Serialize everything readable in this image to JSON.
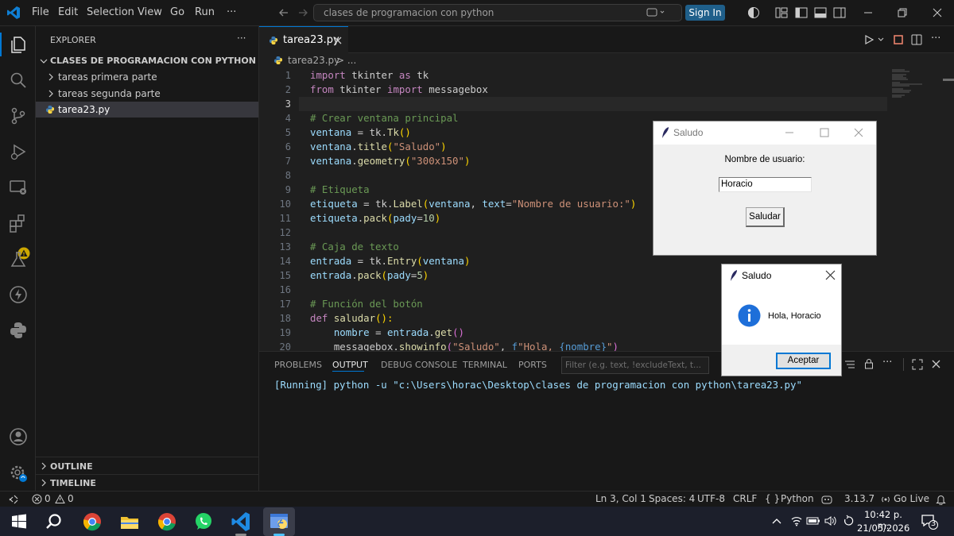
{
  "titlebar": {
    "menus": [
      "File",
      "Edit",
      "Selection",
      "View",
      "Go",
      "Run",
      "···"
    ],
    "search": "clases de programacion con python",
    "signin": "Sign In"
  },
  "sidebar": {
    "header": "EXPLORER",
    "more": "···",
    "folder": "CLASES DE PROGRAMACION CON PYTHON",
    "items": [
      {
        "label": "tareas primera parte"
      },
      {
        "label": "tareas segunda parte"
      },
      {
        "label": "tarea23.py"
      }
    ],
    "outline": "OUTLINE",
    "timeline": "TIMELINE"
  },
  "editor": {
    "tab_label": "tarea23.py",
    "breadcrumb_file": "tarea23.py",
    "breadcrumb_rest": "> ...",
    "line_numbers": [
      "1",
      "2",
      "3",
      "4",
      "5",
      "6",
      "7",
      "8",
      "9",
      "10",
      "11",
      "12",
      "13",
      "14",
      "15",
      "16",
      "17",
      "18",
      "19",
      "20"
    ],
    "code": {
      "l1_a": "import",
      "l1_b": " tkinter ",
      "l1_c": "as",
      "l1_d": " tk",
      "l2_a": "from",
      "l2_b": " tkinter ",
      "l2_c": "import",
      "l2_d": " messagebox",
      "l4": "# Crear ventana principal",
      "l5_a": "ventana",
      "l5_b": " = tk.",
      "l5_c": "Tk",
      "l5_d": "()",
      "l6_a": "ventana",
      "l6_b": ".",
      "l6_c": "title",
      "l6_d": "(",
      "l6_e": "\"Saludo\"",
      "l6_f": ")",
      "l7_a": "ventana",
      "l7_b": ".",
      "l7_c": "geometry",
      "l7_d": "(",
      "l7_e": "\"300x150\"",
      "l7_f": ")",
      "l9": "# Etiqueta",
      "l10_a": "etiqueta",
      "l10_b": " = tk.",
      "l10_c": "Label",
      "l10_d": "(",
      "l10_e": "ventana",
      "l10_f": ", ",
      "l10_g": "text",
      "l10_h": "=",
      "l10_i": "\"Nombre de usuario:\"",
      "l10_j": ")",
      "l11_a": "etiqueta",
      "l11_b": ".",
      "l11_c": "pack",
      "l11_d": "(",
      "l11_e": "pady",
      "l11_f": "=",
      "l11_g": "10",
      "l11_h": ")",
      "l13": "# Caja de texto",
      "l14_a": "entrada",
      "l14_b": " = tk.",
      "l14_c": "Entry",
      "l14_d": "(",
      "l14_e": "ventana",
      "l14_f": ")",
      "l15_a": "entrada",
      "l15_b": ".",
      "l15_c": "pack",
      "l15_d": "(",
      "l15_e": "pady",
      "l15_f": "=",
      "l15_g": "5",
      "l15_h": ")",
      "l17": "# Función del botón",
      "l18_a": "def",
      "l18_b": " ",
      "l18_c": "saludar",
      "l18_d": "():",
      "l19_a": "    ",
      "l19_b": "nombre",
      "l19_c": " = ",
      "l19_d": "entrada",
      "l19_e": ".",
      "l19_f": "get",
      "l19_g": "()",
      "l20_a": "    messagebox.",
      "l20_b": "showinfo",
      "l20_c": "(",
      "l20_d": "\"Saludo\"",
      "l20_e": ", ",
      "l20_f": "f",
      "l20_g": "\"Hola, ",
      "l20_h": "{nombre}",
      "l20_i": "\"",
      "l20_j": ")"
    }
  },
  "panel": {
    "tabs": [
      "PROBLEMS",
      "OUTPUT",
      "DEBUG CONSOLE",
      "TERMINAL",
      "PORTS"
    ],
    "active_tab": "OUTPUT",
    "filter_placeholder": "Filter (e.g. text, !excludeText, t...",
    "output": "[Running] python -u \"c:\\Users\\horac\\Desktop\\clases de programacion con python\\tarea23.py\""
  },
  "statusbar": {
    "errors": "0",
    "warnings": "0",
    "position": "Ln 3, Col 1",
    "spaces": "Spaces: 4",
    "encoding": "UTF-8",
    "eol": "CRLF",
    "language": "Python",
    "python_version": "3.13.7",
    "golive": "Go Live"
  },
  "taskbar": {
    "time": "10:42 p. m.",
    "date": "21/05/2026",
    "notifications": "3"
  },
  "tk_window": {
    "title": "Saludo",
    "label": "Nombre de usuario:",
    "entry_value": "Horacio",
    "button": "Saludar"
  },
  "messagebox": {
    "title": "Saludo",
    "message": "Hola, Horacio",
    "button": "Aceptar"
  },
  "colors": {
    "accent": "#0078d4",
    "signin": "#1f5f8a",
    "warning": "#cca700"
  }
}
